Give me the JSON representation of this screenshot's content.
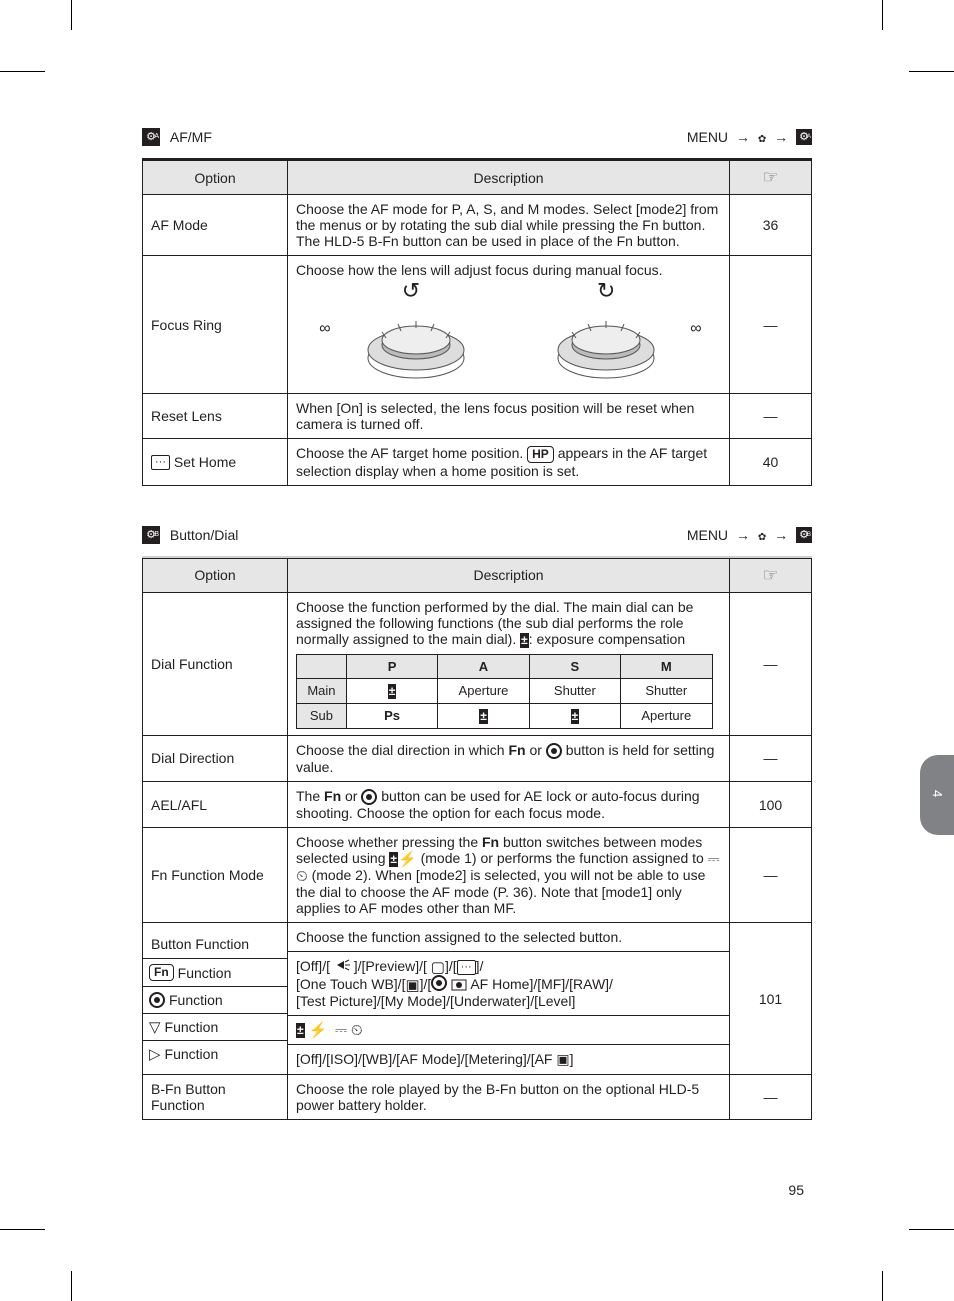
{
  "page_number": "95",
  "side_tab": "4",
  "section_a": {
    "icon": "A",
    "title": "AF/MF",
    "path": [
      "MENU",
      "⚙",
      "A"
    ],
    "headers": {
      "option": "Option",
      "description": "Description",
      "ref": "☞"
    },
    "rows": [
      {
        "opt": "AF Mode",
        "desc": "Choose the AF mode for P, A, S, and M modes. Select [mode2] from the menus or by rotating the sub dial while pressing the Fn button. The HLD-5 B-Fn button can be used in place of the Fn button.",
        "ref": "36"
      },
      {
        "opt": "Focus Ring",
        "desc": "Choose how the lens will adjust focus during manual focus.",
        "ref": "—",
        "dials": {
          "left_label": "∞",
          "right_label": "∞"
        }
      },
      {
        "opt": "Reset Lens",
        "desc": "When [On] is selected, the lens focus position will be reset when camera is turned off.",
        "ref": "—"
      },
      {
        "opt_label": "[···] Set Home",
        "desc": "Choose the AF target home position. [HP] appears in the AF target selection display when a home position is set.",
        "ref": "40"
      }
    ]
  },
  "section_b": {
    "icon": "B",
    "title": "Button/Dial",
    "path": [
      "MENU",
      "⚙",
      "B"
    ],
    "headers": {
      "option": "Option",
      "description": "Description",
      "ref": "☞"
    },
    "dial_function": {
      "opt": "Dial Function",
      "intro": "Choose the function performed by the dial. The main dial can be assigned the following functions (the sub dial performs the role normally assigned to the main dial). ☞: exposure compensation",
      "table": {
        "cols": [
          "P",
          "A",
          "S",
          "M"
        ],
        "rows": [
          {
            "label": "Main",
            "cells": [
              "☞",
              "Aperture",
              "Shutter",
              "Shutter"
            ]
          },
          {
            "label": "Sub",
            "cells": [
              "Ps",
              "☞",
              "☞",
              "Aperture"
            ]
          }
        ]
      },
      "ref": "—"
    },
    "dial_direction": {
      "opt": "Dial Direction",
      "desc": "Choose the dial direction in which Fn or ◉ button is held for setting value.",
      "ref": "—"
    },
    "aelafl": {
      "opt": "AEL/AFL",
      "desc": "The Fn or ◉ button can be used for AE lock or auto-focus during shooting. Choose the option for each focus mode.",
      "ref": "100"
    },
    "fn_mode": {
      "opt": "Fn Function Mode",
      "desc": "Choose whether pressing the Fn button switches between modes selected using ☞⚡ (mode 1) or performs the function assigned to ⎓⏲ (mode 2). When [mode2] is selected, you will not be able to use the dial to choose the AF mode (P. 36). Note that [mode1] only applies to AF modes other than MF.",
      "ref": "—"
    },
    "button_function": {
      "opt": "Button Function",
      "intro": "Choose the function assigned to the selected button.",
      "rows": [
        {
          "key_label": "Fn Function",
          "key_icons": [
            "Fn"
          ],
          "desc": "[Off]/[AF-/MF-/Manual lighting]/[Preview]/[⎓]/[···]/[One Touch WB]/[⎓··]/[AF Home]/[MF]/[RAW]/[◉]/[Test Picture]/[My Mode]/[Underwater]/[Level]"
        },
        {
          "key_label": "Function",
          "key_icons": [
            "●"
          ],
          "desc": ""
        },
        {
          "key_label": "Function",
          "key_icons": [
            "▽"
          ],
          "desc_icons": [
            "☞",
            "⚡",
            "⎓",
            "⏲"
          ]
        },
        {
          "key_label": "Function",
          "key_icons": [
            "▷"
          ],
          "desc": "[Off]/[ISO]/[WB]/[AF Mode]/[Metering]/[AF ▣]"
        }
      ],
      "ref": "101"
    },
    "bfn_button": {
      "opt": "B-Fn Button Function",
      "desc": "Choose the role played by the B-Fn button on the optional HLD-5 power battery holder.",
      "ref": "—"
    }
  }
}
